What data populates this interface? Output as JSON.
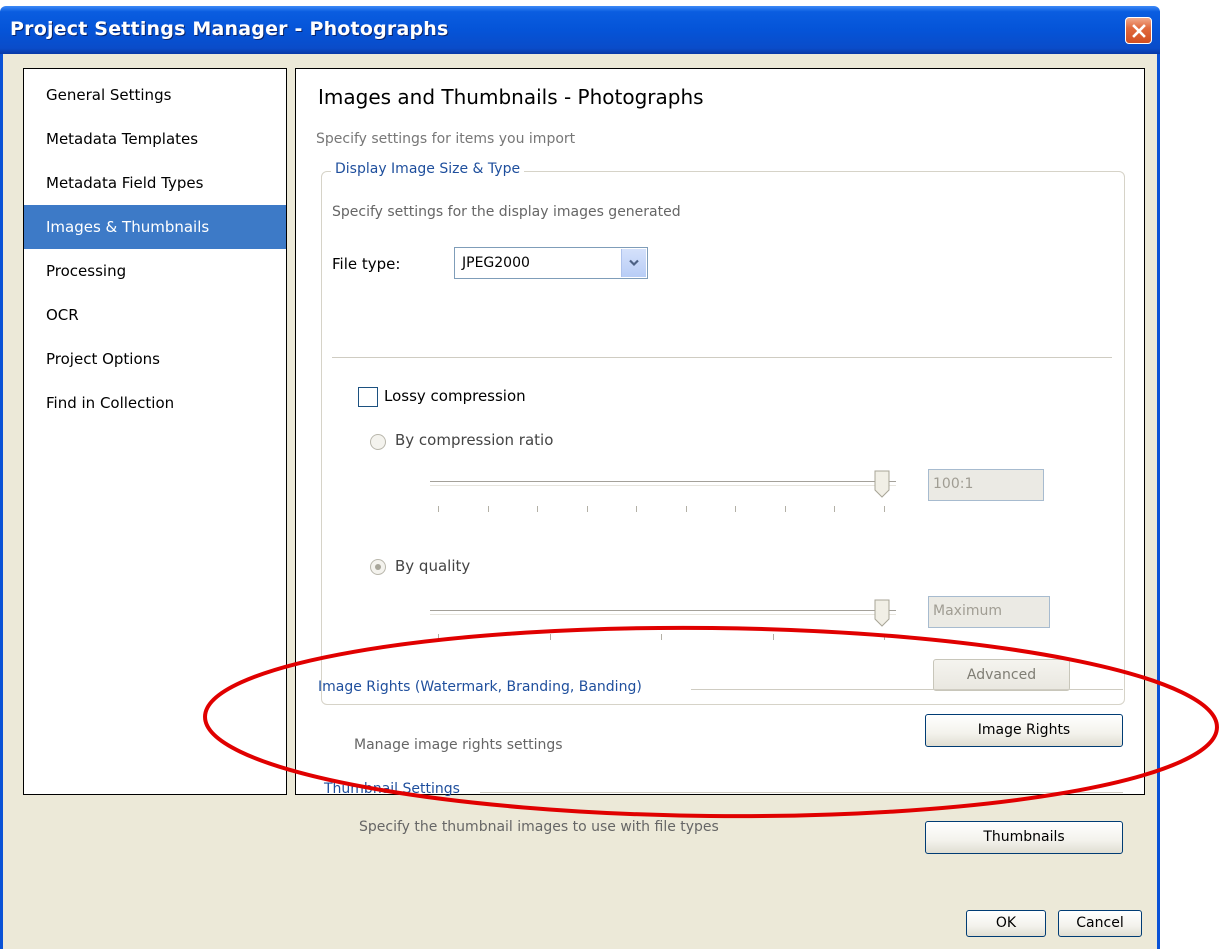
{
  "window": {
    "title": "Project Settings Manager - Photographs",
    "accent_color": "#0554d8",
    "close_icon": "close-icon"
  },
  "sidebar": {
    "items": [
      {
        "label": "General Settings",
        "selected": false
      },
      {
        "label": "Metadata Templates",
        "selected": false
      },
      {
        "label": "Metadata Field Types",
        "selected": false
      },
      {
        "label": "Images & Thumbnails",
        "selected": true
      },
      {
        "label": "Processing",
        "selected": false
      },
      {
        "label": "OCR",
        "selected": false
      },
      {
        "label": "Project Options",
        "selected": false
      },
      {
        "label": "Find in Collection",
        "selected": false
      }
    ],
    "selected_color": "#3d7ac7"
  },
  "main": {
    "title": "Images and Thumbnails - Photographs",
    "subtitle": "Specify settings for items you import",
    "display_group": {
      "legend": "Display Image Size & Type",
      "description": "Specify settings for the display images generated",
      "file_type_label": "File type:",
      "file_type_value": "JPEG2000",
      "lossy_label": "Lossy compression",
      "lossy_checked": false,
      "ratio_radio_label": "By compression ratio",
      "ratio_value": "100:1",
      "ratio_slider_level": 1.0,
      "quality_radio_label": "By quality",
      "quality_selected": true,
      "quality_value": "Maximum",
      "quality_slider_level": 1.0,
      "advanced_label": "Advanced"
    },
    "image_rights": {
      "header": "Image Rights (Watermark, Branding, Banding)",
      "description": "Manage image rights settings",
      "button_label": "Image Rights"
    },
    "thumbnails": {
      "header": "Thumbnail Settings",
      "description": "Specify the thumbnail images to use with file types",
      "button_label": "Thumbnails"
    }
  },
  "footer": {
    "ok_label": "OK",
    "cancel_label": "Cancel"
  },
  "annotation_color": "#e00000"
}
